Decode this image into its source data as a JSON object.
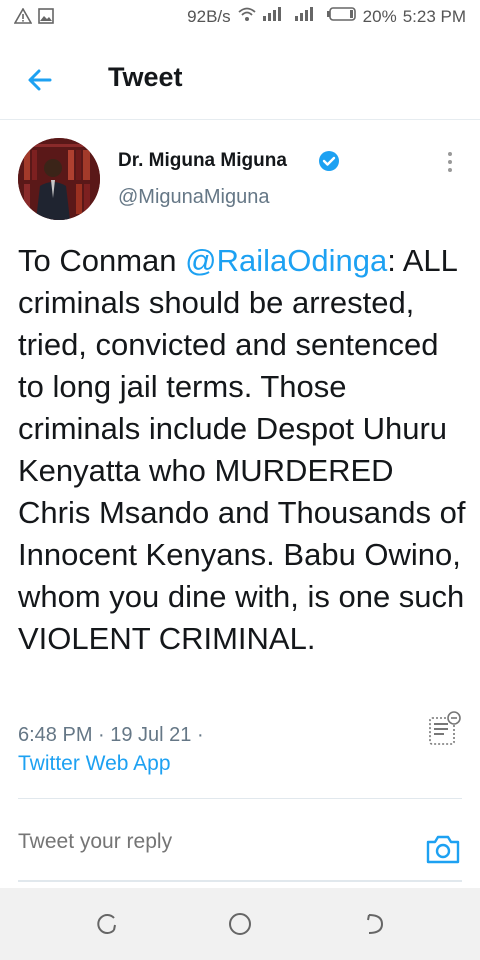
{
  "status_bar": {
    "network_speed": "92B/s",
    "battery": "20%",
    "time": "5:23 PM"
  },
  "header": {
    "title": "Tweet"
  },
  "tweet": {
    "author_name": "Dr. Miguna Miguna",
    "author_handle": "@MigunaMiguna",
    "text_before": "To Conman ",
    "mention": "@RailaOdinga",
    "text_after": ": ALL criminals should be arrested, tried, convicted and sentenced to long jail terms. Those criminals include Despot Uhuru Kenyatta who MURDERED Chris Msando and Thousands of Innocent Kenyans. Babu Owino, whom you dine with, is one such VIOLENT CRIMINAL.",
    "timestamp": "6:48 PM · 19 Jul 21 ·",
    "source": "Twitter Web App"
  },
  "reply": {
    "placeholder": "Tweet your reply"
  },
  "colors": {
    "accent": "#1da1f2",
    "text": "#14171a",
    "muted": "#657786"
  },
  "icons": [
    "back-arrow-icon",
    "verified-badge-icon",
    "more-vertical-icon",
    "reader-mode-icon",
    "camera-icon",
    "nav-recents-icon",
    "nav-home-icon",
    "nav-back-icon"
  ]
}
